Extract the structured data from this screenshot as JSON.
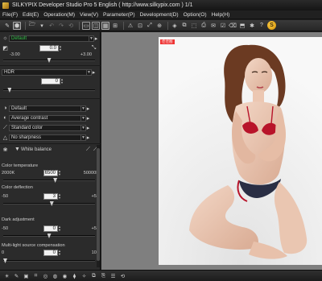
{
  "window": {
    "title": "SILKYPIX Developer Studio Pro 5 English  ( http://www.silkypix.com )    1/1"
  },
  "menu": [
    "File(F)",
    "Edit(E)",
    "Operation(M)",
    "View(V)",
    "Parameter(P)",
    "Development(D)",
    "Option(O)",
    "Help(H)"
  ],
  "panel": {
    "preset": "Default",
    "exposure": {
      "value": "0.0",
      "min": "-3.00",
      "max": "+3.00",
      "level": 0.5
    },
    "hdr": {
      "label": "HDR",
      "value": "0",
      "level": 0.05
    },
    "tone_combo": "Default",
    "contrast_combo": "Average contrast",
    "color_combo": "Standard color",
    "sharpness_combo": "No sharpness",
    "white_balance": {
      "label": "White balance",
      "color_temperature": {
        "label": "Color temperature",
        "value": "6500",
        "min": "2000K",
        "max": "50000K",
        "level": 0.57
      },
      "color_deflection": {
        "label": "Color deflection",
        "value": "3",
        "min": "-50",
        "max": "+50",
        "level": 0.53
      },
      "dark_adjustment": {
        "label": "Dark adjustment",
        "value": "0",
        "min": "-50",
        "max": "+50",
        "level": 0.5
      },
      "multi_light": {
        "label": "Multi-light source compensation",
        "value": "0",
        "min": "0",
        "max": "100",
        "level": 0.0
      }
    }
  },
  "photo": {
    "badge": "佳佳图"
  },
  "colors": {
    "accent": "#f2b01e",
    "preset_text": "#34c04a",
    "viewport_bg": "#7f7f7f"
  }
}
